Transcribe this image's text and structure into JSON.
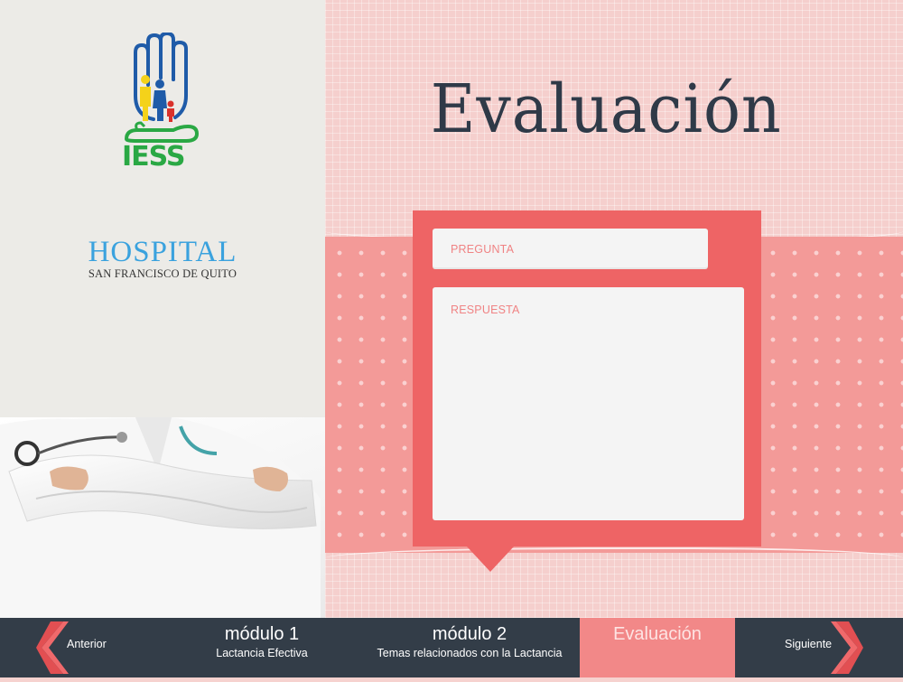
{
  "branding": {
    "logo_text": "IESS",
    "hospital_name": "HOSPITAL",
    "hospital_subtitle": "SAN FRANCISCO DE QUITO"
  },
  "page": {
    "title": "Evaluación"
  },
  "form": {
    "question_label": "PREGUNTA",
    "answer_label": "RESPUESTA"
  },
  "nav": {
    "previous_label": "Anterior",
    "next_label": "Siguiente",
    "modules": [
      {
        "title": "módulo 1",
        "subtitle": "Lactancia Efectiva"
      },
      {
        "title": "módulo 2",
        "subtitle": "Temas relacionados con la Lactancia"
      },
      {
        "title": "Evaluación",
        "subtitle": ""
      }
    ]
  },
  "colors": {
    "accent": "#ee6465",
    "nav_background": "#333d48",
    "arrow": "#f0696b",
    "title": "#2f3a48"
  }
}
